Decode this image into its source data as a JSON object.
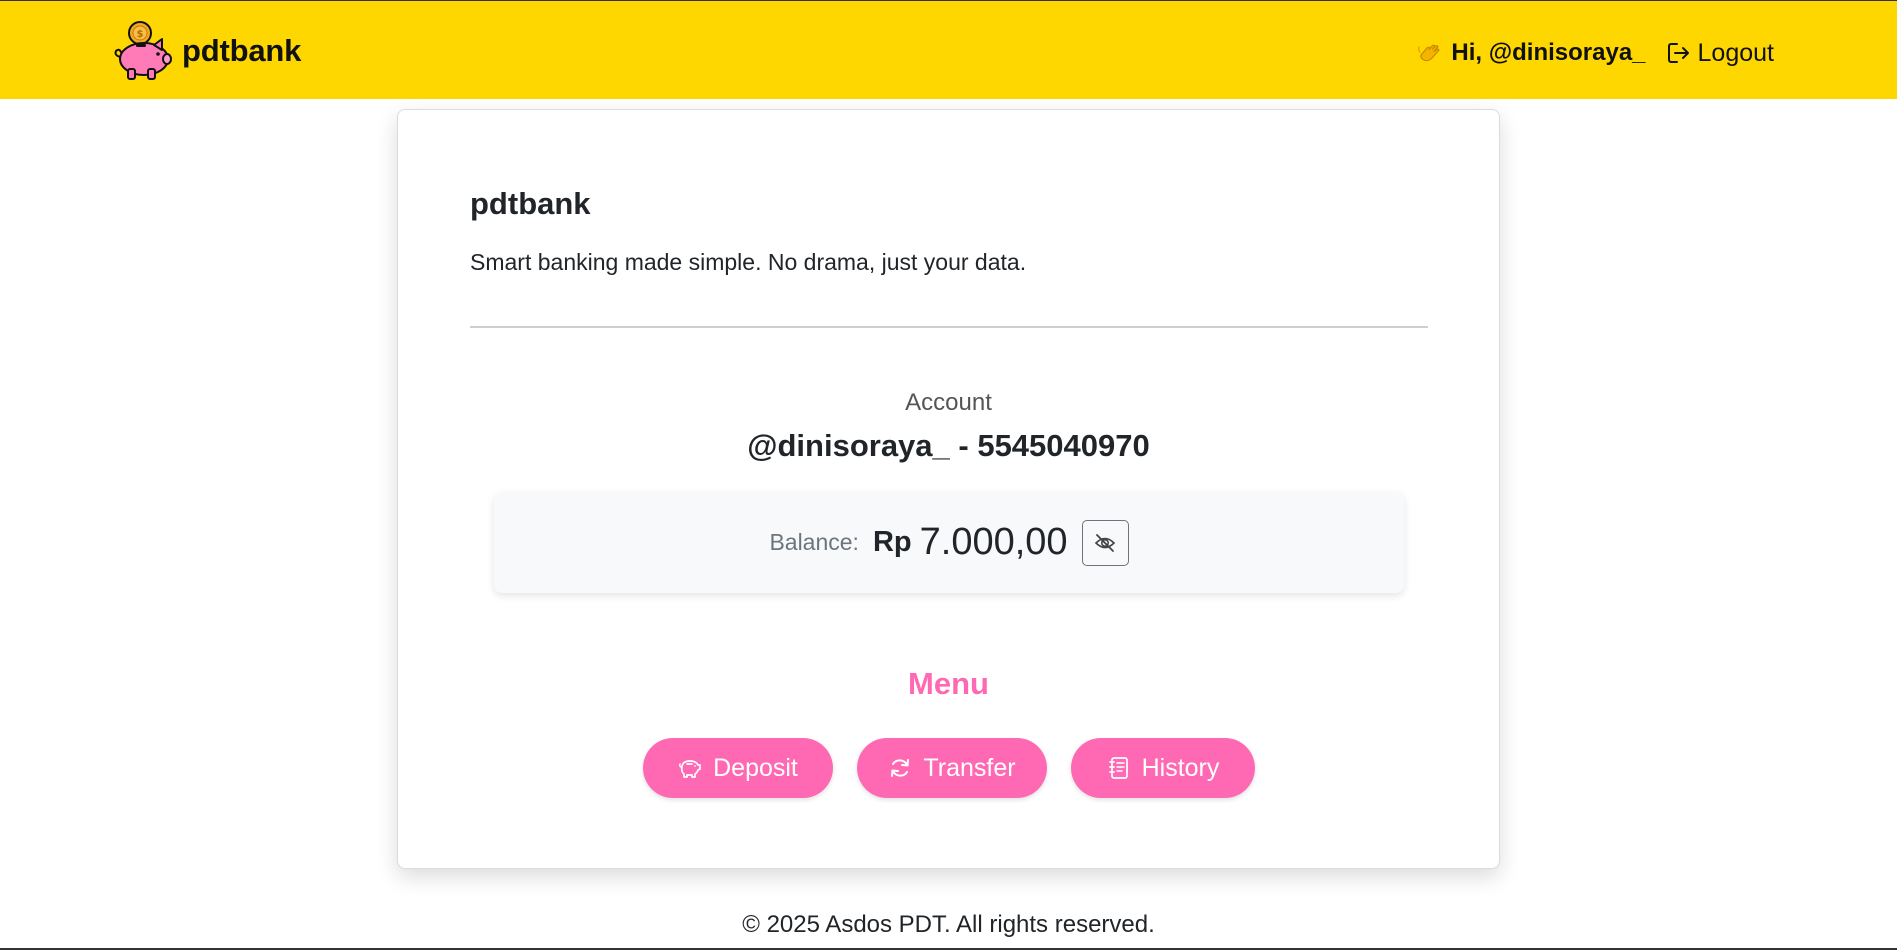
{
  "navbar": {
    "brand_name": "pdtbank",
    "greeting": "Hi, @dinisoraya_",
    "logout_label": "Logout",
    "color": "#FFD700"
  },
  "card": {
    "title": "pdtbank",
    "tagline": "Smart banking made simple. No drama, just your data.",
    "account_label": "Account",
    "account_value": "@dinisoraya_ - 5545040970",
    "balance_label": "Balance:",
    "balance_currency": "Rp",
    "balance_amount": "7.000,00"
  },
  "menu": {
    "title": "Menu",
    "accent": "#FF69B4",
    "buttons": [
      {
        "label": "Deposit",
        "icon": "piggy-bank-icon"
      },
      {
        "label": "Transfer",
        "icon": "refresh-icon"
      },
      {
        "label": "History",
        "icon": "journal-icon"
      }
    ]
  },
  "footer": {
    "text": "© 2025 Asdos PDT. All rights reserved."
  }
}
